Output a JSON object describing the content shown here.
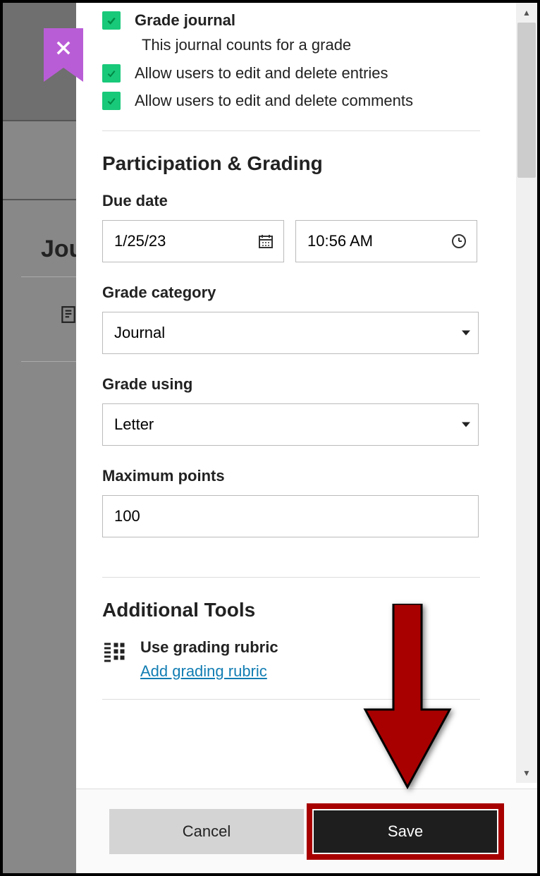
{
  "background": {
    "page_partial_title": "Jou"
  },
  "options": {
    "grade_journal": {
      "label": "Grade journal",
      "description": "This journal counts for a grade"
    },
    "edit_entries": {
      "label": "Allow users to edit and delete entries"
    },
    "edit_comments": {
      "label": "Allow users to edit and delete comments"
    }
  },
  "section_participation_title": "Participation & Grading",
  "due_date": {
    "label": "Due date",
    "date": "1/25/23",
    "time": "10:56 AM"
  },
  "grade_category": {
    "label": "Grade category",
    "value": "Journal"
  },
  "grade_using": {
    "label": "Grade using",
    "value": "Letter"
  },
  "max_points": {
    "label": "Maximum points",
    "value": "100"
  },
  "section_tools_title": "Additional Tools",
  "rubric": {
    "label": "Use grading rubric",
    "link": "Add grading rubric"
  },
  "footer": {
    "cancel": "Cancel",
    "save": "Save"
  }
}
